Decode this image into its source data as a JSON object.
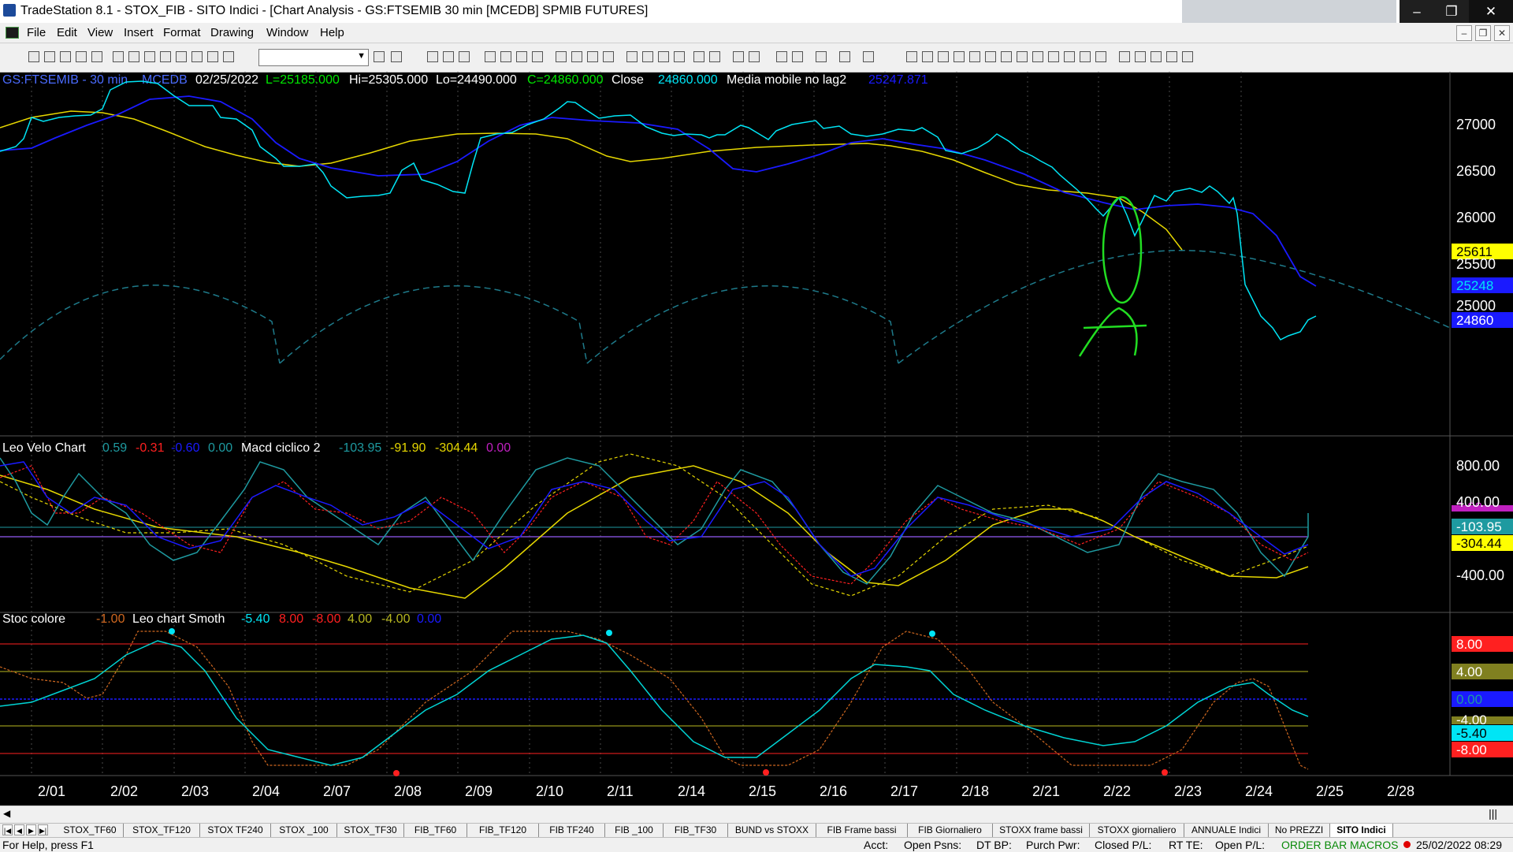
{
  "window": {
    "title": "TradeStation 8.1 - STOX_FIB - SITO Indici - [Chart Analysis - GS:FTSEMIB  30 min  [MCEDB] SPMIB FUTURES]"
  },
  "menu": [
    "File",
    "Edit",
    "View",
    "Insert",
    "Format",
    "Drawing",
    "Window",
    "Help"
  ],
  "price_panel": {
    "symbol": "GS:FTSEMIB - 30 min",
    "exchange": "MCEDB",
    "date": "02/25/2022",
    "last": "L=25185.000",
    "high": "Hi=25305.000",
    "low": "Lo=24490.000",
    "close_eq": "C=24860.000",
    "close_label": "Close",
    "close_value": "24860.000",
    "indicator_name": "Media mobile no lag2",
    "indicator_value": "25247.871",
    "axis_labels": [
      "27000",
      "26500",
      "26000",
      "25500",
      "25000"
    ],
    "badges": [
      "25611",
      "25248",
      "24860"
    ]
  },
  "osc_panel": {
    "name1": "Leo Velo Chart",
    "v1": [
      "0.59",
      "-0.31",
      "-0.60",
      "0.00"
    ],
    "name2": "Macd ciclico 2",
    "v2": [
      "-103.95",
      "-91.90",
      "-304.44",
      "0.00"
    ],
    "axis_labels": [
      "800.00",
      "400.00",
      "-400.00"
    ],
    "badges": [
      "0.00",
      "-103.95",
      "-304.44"
    ]
  },
  "stoc_panel": {
    "name1": "Stoc colore",
    "v1": "-1.00",
    "name2": "Leo chart Smoth",
    "v2": [
      "-5.40",
      "8.00",
      "-8.00",
      "4.00",
      "-4.00",
      "0.00"
    ],
    "badges": [
      "8.00",
      "4.00",
      "0.00",
      "-4.00",
      "-5.40",
      "-8.00"
    ]
  },
  "dates": [
    "2/01",
    "2/02",
    "2/03",
    "2/04",
    "2/07",
    "2/08",
    "2/09",
    "2/10",
    "2/11",
    "2/14",
    "2/15",
    "2/16",
    "2/17",
    "2/18",
    "2/21",
    "2/22",
    "2/23",
    "2/24",
    "2/25",
    "2/28"
  ],
  "colors": {
    "price_dots": "#00e5f5",
    "avg_blue": "#1a1aff",
    "avg_yellow": "#e6d700",
    "cycle": "#1e7a8a",
    "annotation": "#22dd22"
  },
  "tabs": [
    "STOX_TF60",
    "STOX_TF120",
    "STOX TF240",
    "STOX _100",
    "STOX_TF30",
    "FIB_TF60",
    "FIB_TF120",
    "FIB TF240",
    "FIB _100",
    "FIB_TF30",
    "BUND vs STOXX",
    "FIB Frame bassi",
    "FIB Giornaliero",
    "STOXX frame bassi",
    "STOXX giornaliero",
    "ANNUALE Indici",
    "No PREZZI",
    "SITO Indici"
  ],
  "status": {
    "help": "For Help, press F1",
    "acct": "Acct:",
    "open_psns": "Open Psns:",
    "dt_bp": "DT BP:",
    "purch_pwr": "Purch Pwr:",
    "closed_pl": "Closed P/L:",
    "rt_te": "RT TE:",
    "open_pl": "Open P/L:",
    "order_bar": "ORDER BAR",
    "macros": "MACROS",
    "datetime": "25/02/2022 08:29"
  }
}
